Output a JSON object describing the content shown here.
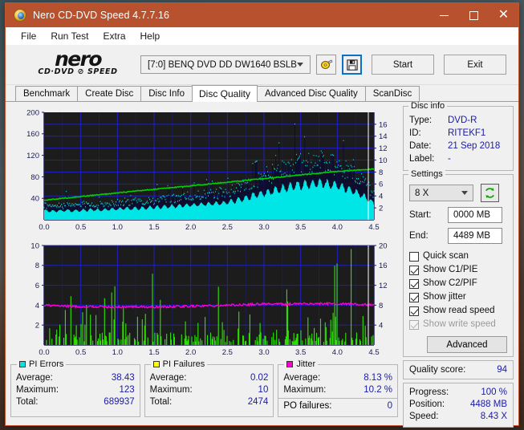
{
  "window": {
    "title": "Nero CD-DVD Speed 4.7.7.16",
    "icon": "nero-app-icon",
    "minimize_label": "–",
    "maximize_label": "□",
    "close_label": "✕",
    "titlebar_color": "#b8522e"
  },
  "menu": {
    "items": [
      "File",
      "Run Test",
      "Extra",
      "Help"
    ]
  },
  "toolbar": {
    "logo_main": "nero",
    "logo_sub": "CD·DVD ⊘ SPEED",
    "drive": "[7:0]   BENQ DVD DD DW1640 BSLB",
    "eject_icon": "disc-eject-icon",
    "save_icon": "floppy-save-icon",
    "start_label": "Start",
    "exit_label": "Exit"
  },
  "tabs": {
    "items": [
      "Benchmark",
      "Create Disc",
      "Disc Info",
      "Disc Quality",
      "Advanced Disc Quality",
      "ScanDisc"
    ],
    "active": "Disc Quality"
  },
  "disc_info": {
    "legend": "Disc info",
    "rows": [
      {
        "key": "Type:",
        "value": "DVD-R"
      },
      {
        "key": "ID:",
        "value": "RITEKF1"
      },
      {
        "key": "Date:",
        "value": "21 Sep 2018"
      },
      {
        "key": "Label:",
        "value": "-"
      }
    ]
  },
  "settings": {
    "legend": "Settings",
    "speed": "8 X",
    "refresh_icon": "refresh-icon",
    "start_label": "Start:",
    "start_value": "0000 MB",
    "end_label": "End:",
    "end_value": "4489 MB",
    "checkboxes": [
      {
        "label": "Quick scan",
        "checked": false,
        "disabled": false
      },
      {
        "label": "Show C1/PIE",
        "checked": true,
        "disabled": false
      },
      {
        "label": "Show C2/PIF",
        "checked": true,
        "disabled": false
      },
      {
        "label": "Show jitter",
        "checked": true,
        "disabled": false
      },
      {
        "label": "Show read speed",
        "checked": true,
        "disabled": false
      },
      {
        "label": "Show write speed",
        "checked": true,
        "disabled": true
      }
    ],
    "advanced_label": "Advanced"
  },
  "quality": {
    "label": "Quality score:",
    "value": "94"
  },
  "progress": {
    "rows": [
      {
        "key": "Progress:",
        "value": "100 %"
      },
      {
        "key": "Position:",
        "value": "4488 MB"
      },
      {
        "key": "Speed:",
        "value": "8.43 X"
      }
    ]
  },
  "stats": {
    "pi_errors": {
      "legend": "PI Errors",
      "color": "#00e5e5",
      "rows": [
        {
          "key": "Average:",
          "value": "38.43"
        },
        {
          "key": "Maximum:",
          "value": "123"
        },
        {
          "key": "Total:",
          "value": "689937"
        }
      ]
    },
    "pi_failures": {
      "legend": "PI Failures",
      "color": "#ffff00",
      "rows": [
        {
          "key": "Average:",
          "value": "0.02"
        },
        {
          "key": "Maximum:",
          "value": "10"
        },
        {
          "key": "Total:",
          "value": "2474"
        }
      ]
    },
    "jitter": {
      "legend": "Jitter",
      "color": "#ff00d0",
      "rows": [
        {
          "key": "Average:",
          "value": "8.13 %"
        },
        {
          "key": "Maximum:",
          "value": "10.2 %"
        }
      ],
      "po_key": "PO failures:",
      "po_value": "0"
    }
  },
  "chart_data": [
    {
      "id": "pie_chart",
      "type": "area",
      "title": "PI Errors / read speed",
      "xlabel": "",
      "ylabel": "PI Errors",
      "xlim": [
        0.0,
        4.5
      ],
      "ylim": [
        0,
        200
      ],
      "y2lim": [
        0,
        18
      ],
      "xticks": [
        0.0,
        0.5,
        1.0,
        1.5,
        2.0,
        2.5,
        3.0,
        3.5,
        4.0,
        4.5
      ],
      "yticks": [
        40,
        80,
        120,
        160,
        200
      ],
      "y2ticks": [
        2,
        4,
        6,
        8,
        10,
        12,
        14,
        16
      ],
      "grid": true,
      "background": "#1c1c1c",
      "gridcolor": "#2020d0",
      "series": [
        {
          "name": "PI Errors",
          "color": "#00e5e5",
          "kind": "area-spikes",
          "x": [
            0.0,
            0.05,
            0.1,
            0.15,
            0.2,
            0.25,
            0.3,
            0.35,
            0.4,
            0.45,
            0.5,
            0.55,
            0.6,
            0.65,
            0.7,
            0.75,
            0.8,
            0.85,
            0.9,
            0.95,
            1.0,
            1.05,
            1.1,
            1.15,
            1.2,
            1.25,
            1.3,
            1.35,
            1.4,
            1.45,
            1.5,
            1.55,
            1.6,
            1.65,
            1.7,
            1.75,
            1.8,
            1.85,
            1.9,
            1.95,
            2.0,
            2.05,
            2.1,
            2.15,
            2.2,
            2.25,
            2.3,
            2.35,
            2.4,
            2.45,
            2.5,
            2.55,
            2.6,
            2.65,
            2.7,
            2.75,
            2.8,
            2.85,
            2.9,
            2.95,
            3.0,
            3.05,
            3.1,
            3.15,
            3.2,
            3.25,
            3.3,
            3.35,
            3.4,
            3.45,
            3.5,
            3.55,
            3.6,
            3.65,
            3.7,
            3.75,
            3.8,
            3.85,
            3.9,
            3.95,
            4.0,
            4.05,
            4.1,
            4.15,
            4.2,
            4.25,
            4.3,
            4.35,
            4.4,
            4.45,
            4.5
          ],
          "values": [
            22,
            20,
            21,
            19,
            22,
            20,
            23,
            21,
            20,
            22,
            21,
            23,
            22,
            24,
            23,
            22,
            24,
            23,
            25,
            24,
            26,
            25,
            27,
            26,
            25,
            27,
            26,
            28,
            27,
            29,
            28,
            30,
            29,
            31,
            30,
            32,
            31,
            33,
            32,
            34,
            35,
            34,
            36,
            35,
            37,
            36,
            38,
            37,
            39,
            38,
            40,
            42,
            44,
            46,
            48,
            50,
            53,
            56,
            58,
            60,
            62,
            64,
            66,
            68,
            70,
            72,
            74,
            76,
            78,
            79,
            80,
            81,
            82,
            82,
            83,
            83,
            84,
            83,
            82,
            81,
            79,
            77,
            74,
            71,
            68,
            64,
            60,
            55,
            50,
            44,
            38
          ],
          "max_spike": 123
        },
        {
          "name": "Read speed",
          "color": "#00d000",
          "kind": "line",
          "axis": "y2",
          "x": [
            0.0,
            0.5,
            1.0,
            1.5,
            2.0,
            2.5,
            3.0,
            3.5,
            4.0,
            4.5
          ],
          "values": [
            3.3,
            3.9,
            4.5,
            5.1,
            5.7,
            6.3,
            6.9,
            7.5,
            8.1,
            8.5
          ]
        }
      ]
    },
    {
      "id": "pif_jitter_chart",
      "type": "bar",
      "title": "PI Failures / jitter",
      "xlabel": "",
      "ylabel": "PI Failures",
      "xlim": [
        0.0,
        4.5
      ],
      "ylim": [
        0,
        10
      ],
      "y2lim": [
        0,
        20
      ],
      "xticks": [
        0.0,
        0.5,
        1.0,
        1.5,
        2.0,
        2.5,
        3.0,
        3.5,
        4.0,
        4.5
      ],
      "yticks": [
        2,
        4,
        6,
        8,
        10
      ],
      "y2ticks": [
        4,
        8,
        12,
        16,
        20
      ],
      "grid": true,
      "background": "#1c1c1c",
      "gridcolor": "#2020d0",
      "series": [
        {
          "name": "PI Failures",
          "color": "#2ee600",
          "kind": "spikes",
          "max": 10,
          "average": 0.02
        },
        {
          "name": "Jitter",
          "color": "#ff00d0",
          "kind": "line",
          "axis": "y2",
          "x": [
            0.0,
            0.25,
            0.5,
            0.75,
            1.0,
            1.25,
            1.5,
            1.75,
            2.0,
            2.25,
            2.5,
            2.75,
            3.0,
            3.25,
            3.5,
            3.75,
            4.0,
            4.25,
            4.5
          ],
          "values": [
            8.0,
            7.8,
            7.7,
            7.7,
            7.6,
            7.7,
            7.6,
            7.7,
            7.8,
            7.9,
            8.0,
            8.1,
            8.3,
            8.2,
            8.3,
            8.3,
            8.3,
            8.2,
            8.0
          ]
        }
      ]
    }
  ]
}
